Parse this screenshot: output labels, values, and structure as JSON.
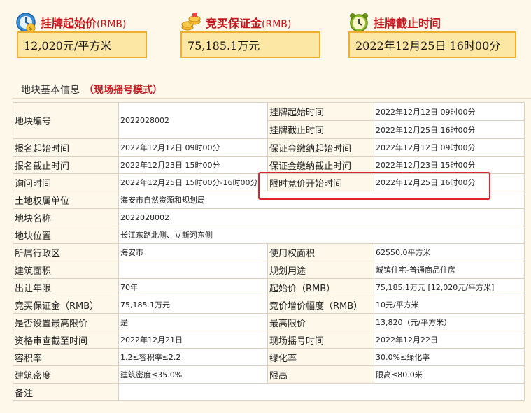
{
  "header": {
    "start_price": {
      "label": "挂牌起始价",
      "unit": "(RMB)",
      "value": "12,020元/平方米",
      "icon": "money-clock-icon"
    },
    "deposit": {
      "label": "竞买保证金",
      "unit": "(RMB)",
      "value": "75,185.1万元",
      "icon": "gold-coins-icon"
    },
    "deadline": {
      "label": "挂牌截止时间",
      "value": "2022年12月25日  16时00分",
      "icon": "alarm-clock-icon"
    }
  },
  "section": {
    "title": "地块基本信息",
    "mode": "（现场摇号模式）"
  },
  "rows": {
    "parcel_no": {
      "label": "地块编号",
      "value": "2022028002"
    },
    "listing_start": {
      "label": "挂牌起始时间",
      "value": "2022年12月12日 09时00分"
    },
    "listing_end": {
      "label": "挂牌截止时间",
      "value": "2022年12月25日 16时00分"
    },
    "reg_start": {
      "label": "报名起始时间",
      "value": "2022年12月12日 09时00分"
    },
    "dep_start": {
      "label": "保证金缴纳起始时间",
      "value": "2022年12月12日 09时00分"
    },
    "reg_end": {
      "label": "报名截止时间",
      "value": "2022年12月23日 15时00分"
    },
    "dep_end": {
      "label": "保证金缴纳截止时间",
      "value": "2022年12月23日 15时00分"
    },
    "inquiry": {
      "label": "询问时间",
      "value": "2022年12月25日 15时00分-16时00分"
    },
    "bid_start": {
      "label": "限时竞价开始时间",
      "value": "2022年12月25日 16时00分"
    },
    "owner": {
      "label": "土地权属单位",
      "value": "海安市自然资源和规划局"
    },
    "parcel_name": {
      "label": "地块名称",
      "value": "2022028002"
    },
    "location": {
      "label": "地块位置",
      "value": "长江东路北侧、立新河东侧"
    },
    "district": {
      "label": "所属行政区",
      "value": "海安市"
    },
    "use_area": {
      "label": "使用权面积",
      "value": "62550.0平方米"
    },
    "build_area": {
      "label": "建筑面积",
      "value": ""
    },
    "planned_use": {
      "label": "规划用途",
      "value": "城镇住宅-普通商品住房"
    },
    "term": {
      "label": "出让年限",
      "value": "70年"
    },
    "start_price": {
      "label": "起始价（RMB）",
      "value": "75,185.1万元 [12,020元/平方米]"
    },
    "deposit": {
      "label": "竞买保证金（RMB）",
      "value": "75,185.1万元"
    },
    "increment": {
      "label": "竞价增价幅度（RMB）",
      "value": "10元/平方米"
    },
    "max_limit_set": {
      "label": "是否设置最高限价",
      "value": "是"
    },
    "max_price": {
      "label": "最高限价",
      "value": "13,820（元/平方米）"
    },
    "qual_deadline": {
      "label": "资格审查截至时间",
      "value": "2022年12月21日"
    },
    "lottery_time": {
      "label": "现场摇号时间",
      "value": "2022年12月22日"
    },
    "far": {
      "label": "容积率",
      "value": "1.2≤容积率≤2.2"
    },
    "green": {
      "label": "绿化率",
      "value": "30.0%≤绿化率"
    },
    "density": {
      "label": "建筑密度",
      "value": "建筑密度≤35.0%"
    },
    "height": {
      "label": "限高",
      "value": "限高≤80.0米"
    },
    "remarks": {
      "label": "备注",
      "value": ""
    }
  }
}
